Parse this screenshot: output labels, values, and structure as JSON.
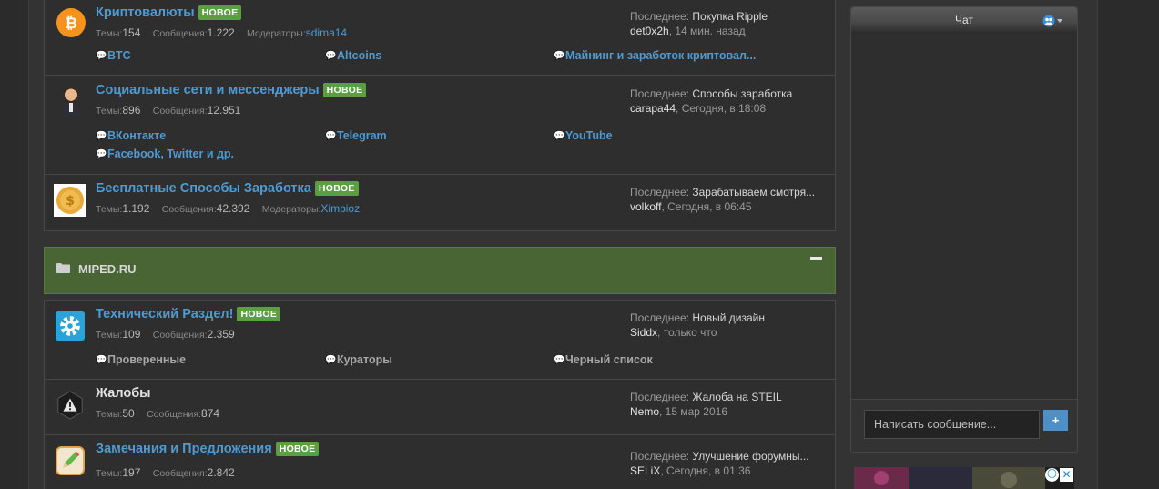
{
  "colors": {
    "accent": "#4e9ad2",
    "badge_new": "#5c9e42",
    "category_bg": "#496534"
  },
  "badge_new": "НОВОЕ",
  "labels": {
    "threads": "Темы:",
    "messages": "Сообщения:",
    "moderators": "Модераторы:",
    "last": "Последнее:"
  },
  "nodes": {
    "crypto": {
      "title": "Криптовалюты",
      "threads": "154",
      "messages": "1.222",
      "moderator": "sdima14",
      "last_title": "Покупка Ripple",
      "last_user": "det0x2h",
      "last_time": ", 14 мин. назад",
      "subforums": [
        "BTC",
        "Altcoins",
        "Майнинг и заработок криптовал..."
      ]
    },
    "social": {
      "title": "Социальные сети и мессенджеры",
      "threads": "896",
      "messages": "12.951",
      "last_title": "Способы заработка",
      "last_user": "carapa44",
      "last_time": ", Сегодня, в 18:08",
      "subforums": [
        "ВКонтакте",
        "Telegram",
        "YouTube",
        "Facebook, Twitter и др."
      ]
    },
    "free": {
      "title": "Бесплатные Способы Заработка",
      "threads": "1.192",
      "messages": "42.392",
      "moderator": "Ximbioz",
      "last_title": "Зарабатываем смотря...",
      "last_user": "volkoff",
      "last_time": ", Сегодня, в 06:45"
    },
    "tech": {
      "title": "Технический Раздел!",
      "threads": "109",
      "messages": "2.359",
      "last_title": "Новый дизайн",
      "last_user": "Siddx",
      "last_time": ", только что",
      "subforums": [
        "Проверенные",
        "Кураторы",
        "Черный список"
      ]
    },
    "complaints": {
      "title": "Жалобы",
      "threads": "50",
      "messages": "874",
      "last_title": "Жалоба на STEIL",
      "last_user": "Nemo",
      "last_time": ", 15 мар 2016"
    },
    "suggestions": {
      "title": "Замечания и Предложения",
      "threads": "197",
      "messages": "2.842",
      "last_title": "Улучшение форумны...",
      "last_user": "SELiX",
      "last_time": ", Сегодня, в 01:36"
    }
  },
  "category": {
    "title": "MIPED.RU"
  },
  "chat": {
    "title": "Чат",
    "placeholder": "Написать сообщение...",
    "send_label": "+"
  },
  "ad": {
    "info": "ⓘ",
    "close": "✕"
  }
}
